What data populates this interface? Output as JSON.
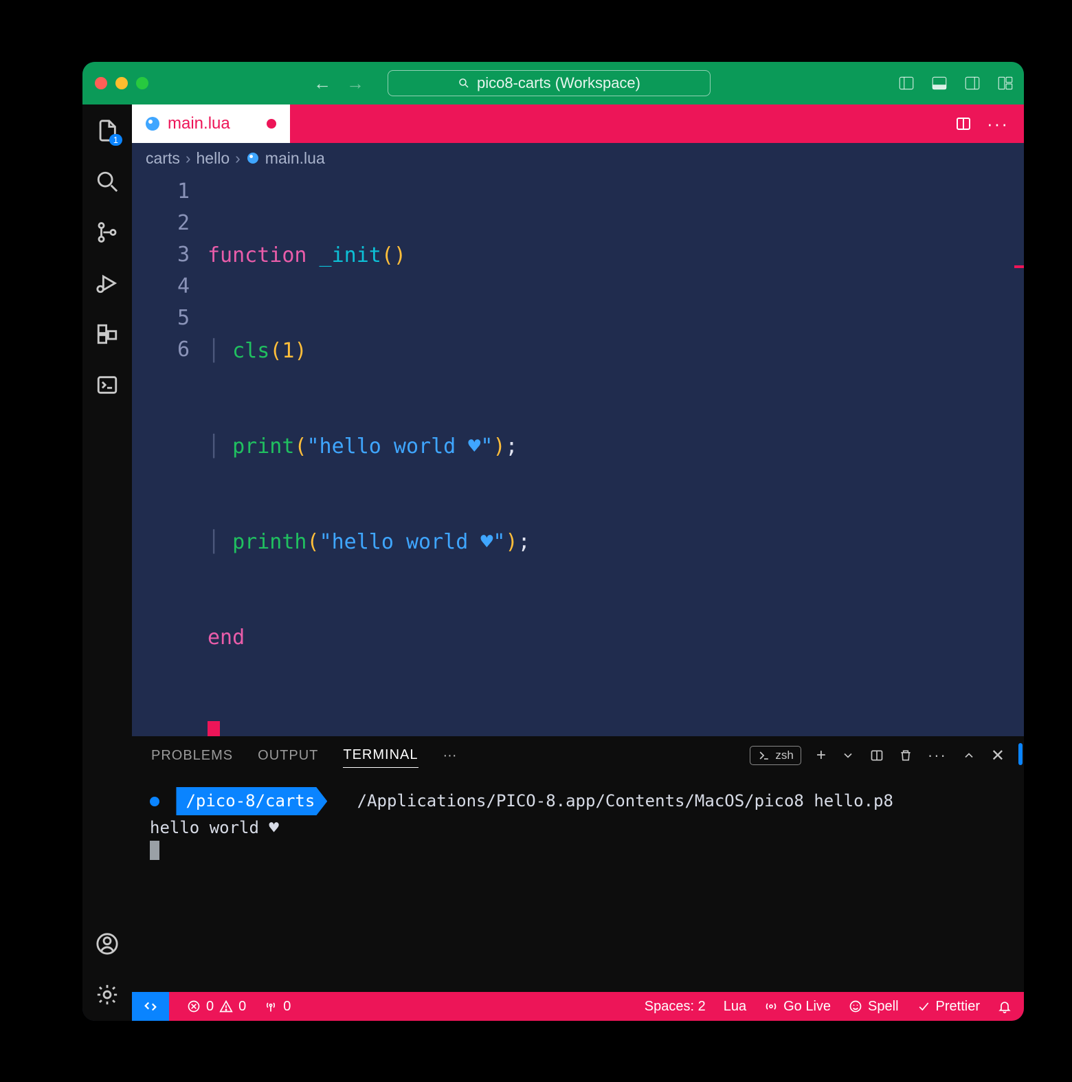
{
  "titlebar": {
    "search_text": "pico8-carts (Workspace)"
  },
  "activitybar": {
    "explorer_badge": "1"
  },
  "tabs": {
    "active": {
      "label": "main.lua"
    }
  },
  "breadcrumb": {
    "seg0": "carts",
    "seg1": "hello",
    "seg2": "main.lua"
  },
  "editor": {
    "line_numbers": [
      "1",
      "2",
      "3",
      "4",
      "5",
      "6"
    ],
    "l1": {
      "kw": "function",
      "name": " _init",
      "paren": "()"
    },
    "l2": {
      "call": "cls",
      "arg": "1"
    },
    "l3": {
      "call": "print",
      "str": "\"hello world ♥\""
    },
    "l4": {
      "call": "printh",
      "str": "\"hello world ♥\""
    },
    "l5": {
      "kw": "end"
    }
  },
  "panel": {
    "tabs": {
      "problems": "PROBLEMS",
      "output": "OUTPUT",
      "terminal": "TERMINAL"
    },
    "shell_label": "zsh",
    "terminal": {
      "prompt_path": "/pico-8/carts",
      "command": "/Applications/PICO-8.app/Contents/MacOS/pico8 hello.p8",
      "output1": "hello world ♥"
    }
  },
  "statusbar": {
    "errors": "0",
    "warnings": "0",
    "ports": "0",
    "spaces": "Spaces: 2",
    "lang": "Lua",
    "golive": "Go Live",
    "spell": "Spell",
    "prettier": "Prettier"
  }
}
